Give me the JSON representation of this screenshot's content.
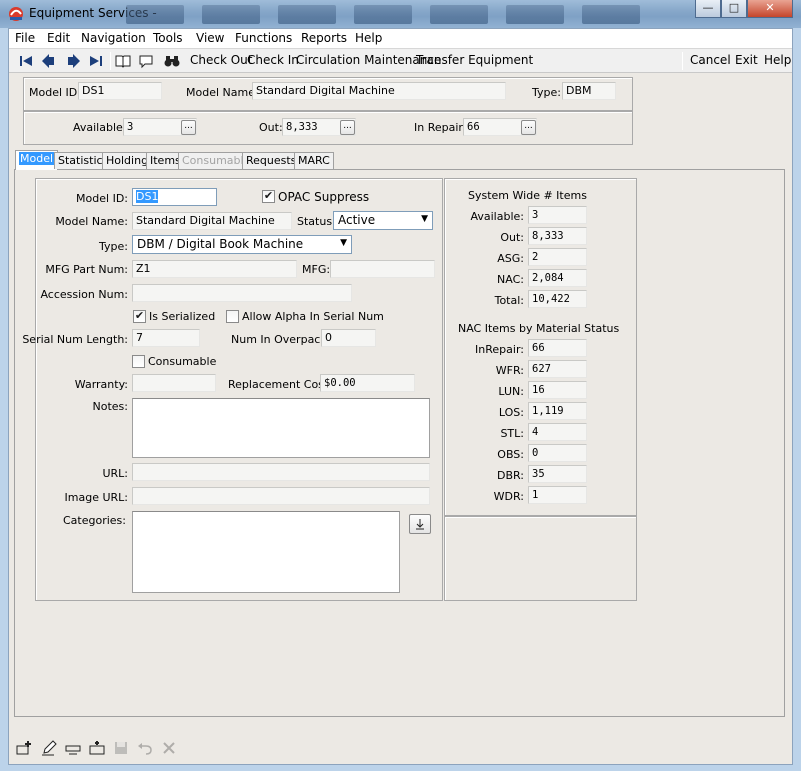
{
  "window": {
    "title": "Equipment Services -"
  },
  "menu": [
    "File",
    "Edit",
    "Navigation",
    "Tools",
    "View",
    "Functions",
    "Reports",
    "Help"
  ],
  "toolbar": {
    "check_out": "Check Out",
    "check_in": "Check In",
    "circulation_maintenance": "Circulation Maintenance",
    "transfer_equipment": "Transfer Equipment",
    "cancel": "Cancel",
    "exit": "Exit",
    "help": "Help"
  },
  "header": {
    "model_id_label": "Model ID:",
    "model_id": "DS1",
    "model_name_label": "Model Name:",
    "model_name": "Standard Digital Machine",
    "type_label": "Type:",
    "type": "DBM",
    "available_label": "Available:",
    "available": "3",
    "out_label": "Out:",
    "out": "8,333",
    "in_repair_label": "In Repair:",
    "in_repair": "66",
    "ellipsis": "..."
  },
  "tabs": [
    "Model",
    "Statistics",
    "Holding",
    "Items",
    "Consumable",
    "Requests",
    "MARC"
  ],
  "form": {
    "model_id_label": "Model ID:",
    "model_id": "DS1",
    "opac_suppress_label": "OPAC Suppress",
    "opac_suppress_checked": "✔",
    "model_name_label": "Model Name:",
    "model_name": "Standard Digital Machine",
    "status_label": "Status:",
    "status": "Active",
    "type_label": "Type:",
    "type": "DBM / Digital Book Machine",
    "mfg_part_num_label": "MFG Part Num:",
    "mfg_part_num": "Z1",
    "mfg_label": "MFG:",
    "mfg": "",
    "accession_num_label": "Accession Num:",
    "accession_num": "",
    "is_serialized_label": "Is Serialized",
    "is_serialized_checked": "✔",
    "allow_alpha_label": "Allow Alpha In Serial Num",
    "serial_num_length_label": "Serial Num Length:",
    "serial_num_length": "7",
    "num_in_overpack_label": "Num In Overpack:",
    "num_in_overpack": "0",
    "consumable_label": "Consumable",
    "warranty_label": "Warranty:",
    "warranty": "",
    "replacement_cost_label": "Replacement Cost:",
    "replacement_cost": "$0.00",
    "notes_label": "Notes:",
    "url_label": "URL:",
    "image_url_label": "Image URL:",
    "categories_label": "Categories:"
  },
  "system_wide": {
    "title": "System Wide # Items",
    "rows": [
      {
        "label": "Available:",
        "value": "3"
      },
      {
        "label": "Out:",
        "value": "8,333"
      },
      {
        "label": "ASG:",
        "value": "2"
      },
      {
        "label": "NAC:",
        "value": "2,084"
      },
      {
        "label": "Total:",
        "value": "10,422"
      }
    ]
  },
  "nac_status": {
    "title": "NAC Items by Material Status",
    "rows": [
      {
        "label": "InRepair:",
        "value": "66"
      },
      {
        "label": "WFR:",
        "value": "627"
      },
      {
        "label": "LUN:",
        "value": "16"
      },
      {
        "label": "LOS:",
        "value": "1,119"
      },
      {
        "label": "STL:",
        "value": "4"
      },
      {
        "label": "OBS:",
        "value": "0"
      },
      {
        "label": "DBR:",
        "value": "35"
      },
      {
        "label": "WDR:",
        "value": "1"
      }
    ]
  }
}
